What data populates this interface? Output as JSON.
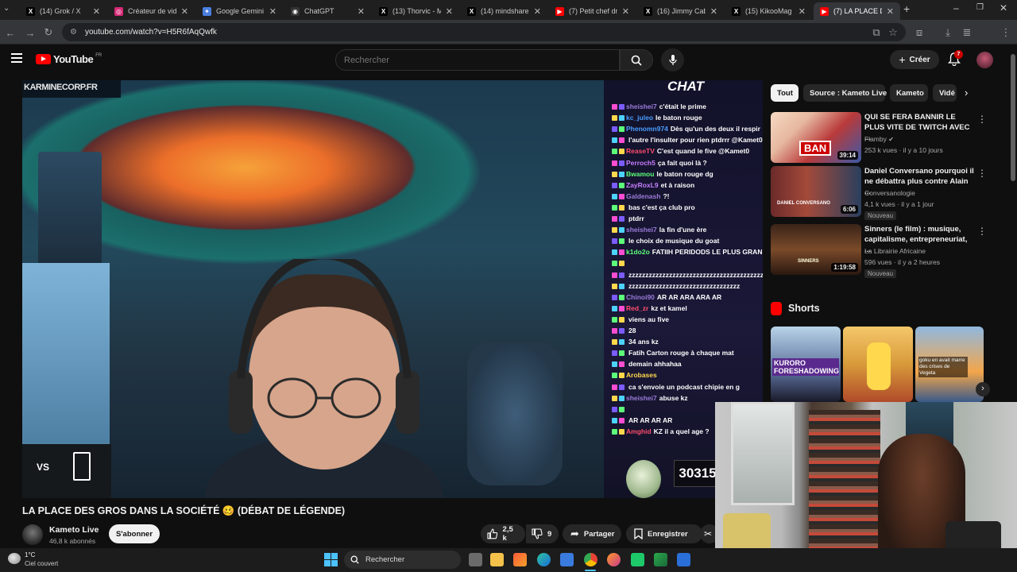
{
  "browser": {
    "tabs": [
      {
        "label": "(14) Grok / X",
        "icon": "x-icon"
      },
      {
        "label": "Créateur de vidéo",
        "icon": "instagram-icon"
      },
      {
        "label": "Google Gemini",
        "icon": "gemini-icon"
      },
      {
        "label": "ChatGPT",
        "icon": "chatgpt-icon"
      },
      {
        "label": "(13) Thorvic - M",
        "icon": "x-icon"
      },
      {
        "label": "(14) mindshare su",
        "icon": "x-icon"
      },
      {
        "label": "(7) Petit chef dra",
        "icon": "youtube-icon"
      },
      {
        "label": "(16) Jimmy Cabot",
        "icon": "x-icon"
      },
      {
        "label": "(15) KikooMag su",
        "icon": "x-icon"
      },
      {
        "label": "(7) LA PLACE DES",
        "icon": "youtube-icon"
      }
    ],
    "url": "youtube.com/watch?v=H5R6fAqQwfk"
  },
  "youtube": {
    "logo_text": "YouTube",
    "region": "FR",
    "search_placeholder": "Rechercher",
    "create_label": "Créer",
    "notification_count": "7"
  },
  "video": {
    "title": "LA PLACE DES GROS DANS LA SOCIÉTÉ 🥴 (DÉBAT DE LÉGENDE)",
    "overlay_site": "KARMINECORP.FR",
    "chat_header": "CHAT",
    "vs_label": "VS",
    "counter_value": "30315",
    "chat": [
      {
        "user": "sheishei7",
        "msg": "c'était le prime",
        "color": "#9b7bd9"
      },
      {
        "user": "kc_juleo",
        "msg": "le baton rouge",
        "color": "#4a9eff"
      },
      {
        "user": "Phenomn974",
        "msg": "Dès qu'un des deux il respir",
        "color": "#4a9eff"
      },
      {
        "user": "",
        "msg": "l'autre l'insulter pour rien ptdrrr @Kamet0",
        "color": "#ffffff"
      },
      {
        "user": "ReaseTV",
        "msg": "C'est quand le five @Kamet0",
        "color": "#ff4d6d"
      },
      {
        "user": "Perroch5",
        "msg": "ça fait quoi là ?",
        "color": "#c77dff"
      },
      {
        "user": "Bwamou",
        "msg": "le baton rouge dg",
        "color": "#5cff7a"
      },
      {
        "user": "ZayRoxL9",
        "msg": "et à raison",
        "color": "#c77dff"
      },
      {
        "user": "Galdenash",
        "msg": "?!",
        "color": "#9b7bd9"
      },
      {
        "user": "",
        "msg": "bas c'est ça club pro",
        "color": "#ffffff"
      },
      {
        "user": "",
        "msg": "ptdrr",
        "color": "#ffffff"
      },
      {
        "user": "sheishei7",
        "msg": "la fin d'une ère",
        "color": "#9b7bd9"
      },
      {
        "user": "",
        "msg": "le choix de musique du goat",
        "color": "#ffffff"
      },
      {
        "user": "k1do2o",
        "msg": "FATIIH PERIDODS LE PLUS GRAN",
        "color": "#5cff7a"
      },
      {
        "user": "",
        "msg": "",
        "color": "#ffffff"
      },
      {
        "user": "",
        "msg": "zzzzzzzzzzzzzzzzzzzzzzzzzzzzzzzzzzzzzzzzz",
        "color": "#ffffff"
      },
      {
        "user": "",
        "msg": "zzzzzzzzzzzzzzzzzzzzzzzzzzzzzzzzz",
        "color": "#ffffff"
      },
      {
        "user": "Chinoi90",
        "msg": "AR AR ARA ARA AR",
        "color": "#9b7bd9"
      },
      {
        "user": "Red_zr",
        "msg": "kz et kamel",
        "color": "#ff4d6d"
      },
      {
        "user": "",
        "msg": "viens au five",
        "color": "#ffffff"
      },
      {
        "user": "",
        "msg": "28",
        "color": "#ffffff"
      },
      {
        "user": "",
        "msg": "34 ans kz",
        "color": "#ffffff"
      },
      {
        "user": "",
        "msg": "Fatih Carton rouge à chaque mat",
        "color": "#ffffff"
      },
      {
        "user": "",
        "msg": "demain ahhahaa",
        "color": "#ffffff"
      },
      {
        "user": "Arobases",
        "msg": "",
        "color": "#ffd84d"
      },
      {
        "user": "",
        "msg": "ca s'envoie un podcast chipie en g",
        "color": "#ffffff"
      },
      {
        "user": "sheishei7",
        "msg": "abuse kz",
        "color": "#9b7bd9"
      },
      {
        "user": "",
        "msg": "",
        "color": "#ffffff"
      },
      {
        "user": "",
        "msg": "AR AR AR AR",
        "color": "#ffffff"
      },
      {
        "user": "Amghid",
        "msg": "KZ il a quel age ?",
        "color": "#ff4d6d"
      }
    ]
  },
  "channel": {
    "name": "Kameto Live",
    "subs": "46,8 k abonnés",
    "subscribe_label": "S'abonner"
  },
  "actions": {
    "likes": "2,5 k",
    "dislikes": "9",
    "share": "Partager",
    "save": "Enregistrer"
  },
  "chips": [
    "Tout",
    "Source : Kameto Live",
    "Kameto",
    "Vidé"
  ],
  "recommendations": [
    {
      "title": "QUI SE FERA BANNIR LE PLUS VITE DE TWITCH AVEC ...",
      "channel": "Flamby",
      "meta": "253 k vues · il y a 10 jours",
      "duration": "39:14",
      "badge": "",
      "thumb_text": "BAN"
    },
    {
      "title": "Daniel Conversano pourquoi il ne débattra plus contre Alain ...",
      "channel": "Conversanologie",
      "meta": "4,1 k vues · il y a 1 jour",
      "duration": "6:06",
      "badge": "Nouveau",
      "thumb_text": "DANIEL CONVERSANO"
    },
    {
      "title": "Sinners (le film) : musique, capitalisme, entrepreneuriat, ...",
      "channel": "La Librairie Africaine",
      "meta": "596 vues · il y a 2 heures",
      "duration": "1:19:58",
      "badge": "Nouveau",
      "thumb_text": "SINNERS"
    }
  ],
  "shorts": {
    "heading": "Shorts",
    "items": [
      {
        "caption": "KURORO FORESHADOWING"
      },
      {
        "caption": ""
      },
      {
        "caption": "goku en avait marre des crises de Vegeta"
      }
    ]
  },
  "taskbar": {
    "temp": "1°C",
    "weather": "Ciel couvert",
    "search_label": "Rechercher"
  }
}
